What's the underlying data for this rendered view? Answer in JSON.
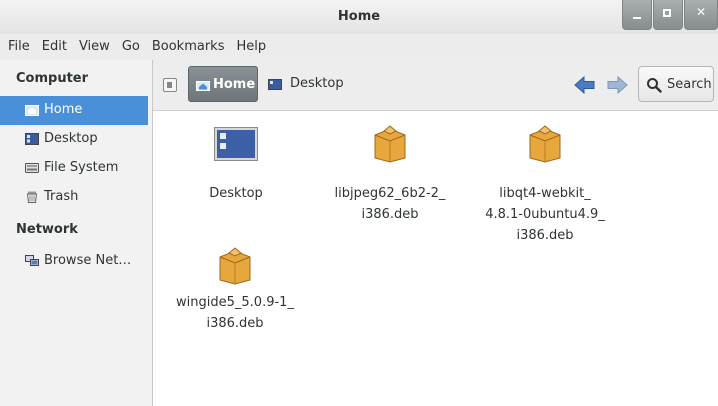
{
  "window": {
    "title": "Home"
  },
  "menubar": {
    "items": [
      "File",
      "Edit",
      "View",
      "Go",
      "Bookmarks",
      "Help"
    ]
  },
  "sidebar": {
    "sections": [
      {
        "heading": "Computer",
        "items": [
          {
            "label": "Home",
            "icon": "home-folder-icon",
            "selected": true
          },
          {
            "label": "Desktop",
            "icon": "desktop-icon",
            "selected": false
          },
          {
            "label": "File System",
            "icon": "hard-drive-icon",
            "selected": false
          },
          {
            "label": "Trash",
            "icon": "trash-icon",
            "selected": false
          }
        ]
      },
      {
        "heading": "Network",
        "items": [
          {
            "label": "Browse Net…",
            "icon": "network-icon",
            "selected": false
          }
        ]
      }
    ]
  },
  "pathbar": {
    "crumbs": [
      {
        "label": "Home",
        "icon": "home-folder-icon",
        "active": true
      },
      {
        "label": "Desktop",
        "icon": "desktop-icon",
        "active": false
      }
    ],
    "search_label": "Search"
  },
  "files": [
    {
      "name": "Desktop",
      "icon": "desktop-folder-icon"
    },
    {
      "name": "libjpeg62_6b2-2_\ni386.deb",
      "icon": "package-icon"
    },
    {
      "name": "libqt4-webkit_\n4.8.1-0ubuntu4.9_\ni386.deb",
      "icon": "package-icon"
    },
    {
      "name": "wingide5_5.0.9-1_\ni386.deb",
      "icon": "package-icon"
    }
  ],
  "colors": {
    "selection": "#4a90d9",
    "arrow": "#4a7cc1"
  }
}
